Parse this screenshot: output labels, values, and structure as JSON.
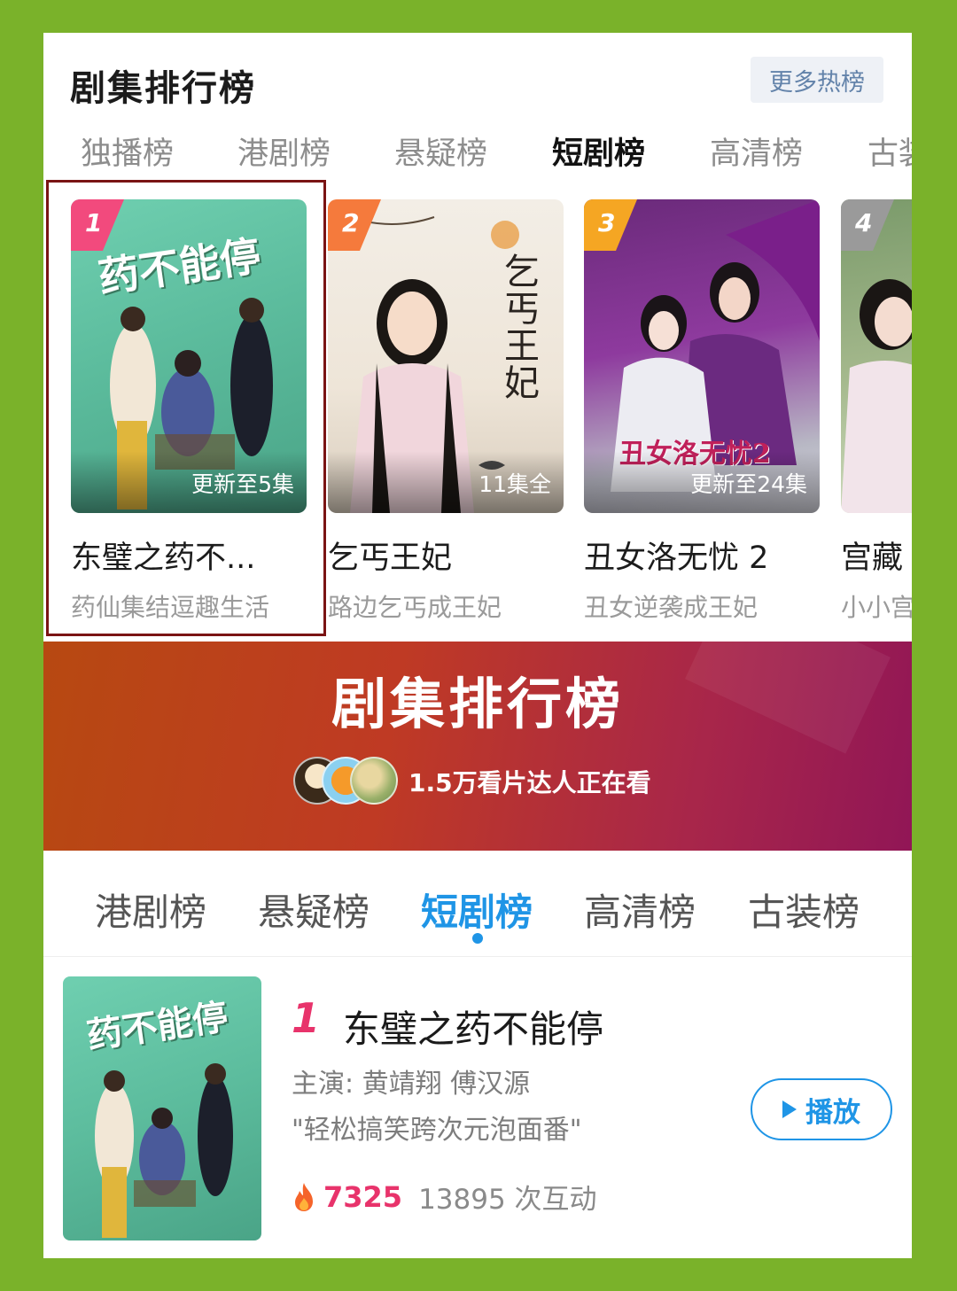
{
  "top": {
    "title": "剧集排行榜",
    "more_button": "更多热榜",
    "tabs": [
      "独播榜",
      "港剧榜",
      "悬疑榜",
      "短剧榜",
      "高清榜",
      "古装榜"
    ],
    "active_tab": "短剧榜"
  },
  "cards": [
    {
      "rank": "1",
      "status": "更新至5集",
      "title": "东璧之药不...",
      "desc": "药仙集结逗趣生活",
      "poster_text": "药不能停"
    },
    {
      "rank": "2",
      "status": "11集全",
      "title": "乞丐王妃",
      "desc": "路边乞丐成王妃",
      "poster_text": "乞丐王妃"
    },
    {
      "rank": "3",
      "status": "更新至24集",
      "title": "丑女洛无忧 2",
      "desc": "丑女逆袭成王妃",
      "poster_text": "丑女洛无忧2"
    },
    {
      "rank": "4",
      "status": "",
      "title": "宫藏",
      "desc": "小小宫",
      "poster_text": ""
    }
  ],
  "banner": {
    "title": "剧集排行榜",
    "viewers_text": "1.5万看片达人正在看"
  },
  "rank_tabs": [
    "港剧榜",
    "悬疑榜",
    "短剧榜",
    "高清榜",
    "古装榜"
  ],
  "rank_tabs_active": "短剧榜",
  "detail": {
    "rank": "1",
    "title": "东璧之药不能停",
    "cast": "主演: 黄靖翔  傅汉源",
    "quote": "\"轻松搞笑跨次元泡面番\"",
    "play_label": "播放",
    "heat": "7325",
    "interactions": "13895 次互动",
    "poster_text": "药不能停"
  },
  "colors": {
    "accent_blue": "#1f95e6",
    "rank_pink": "#e8336b",
    "frame_green": "#7ab22a",
    "highlight": "#7a1414"
  }
}
